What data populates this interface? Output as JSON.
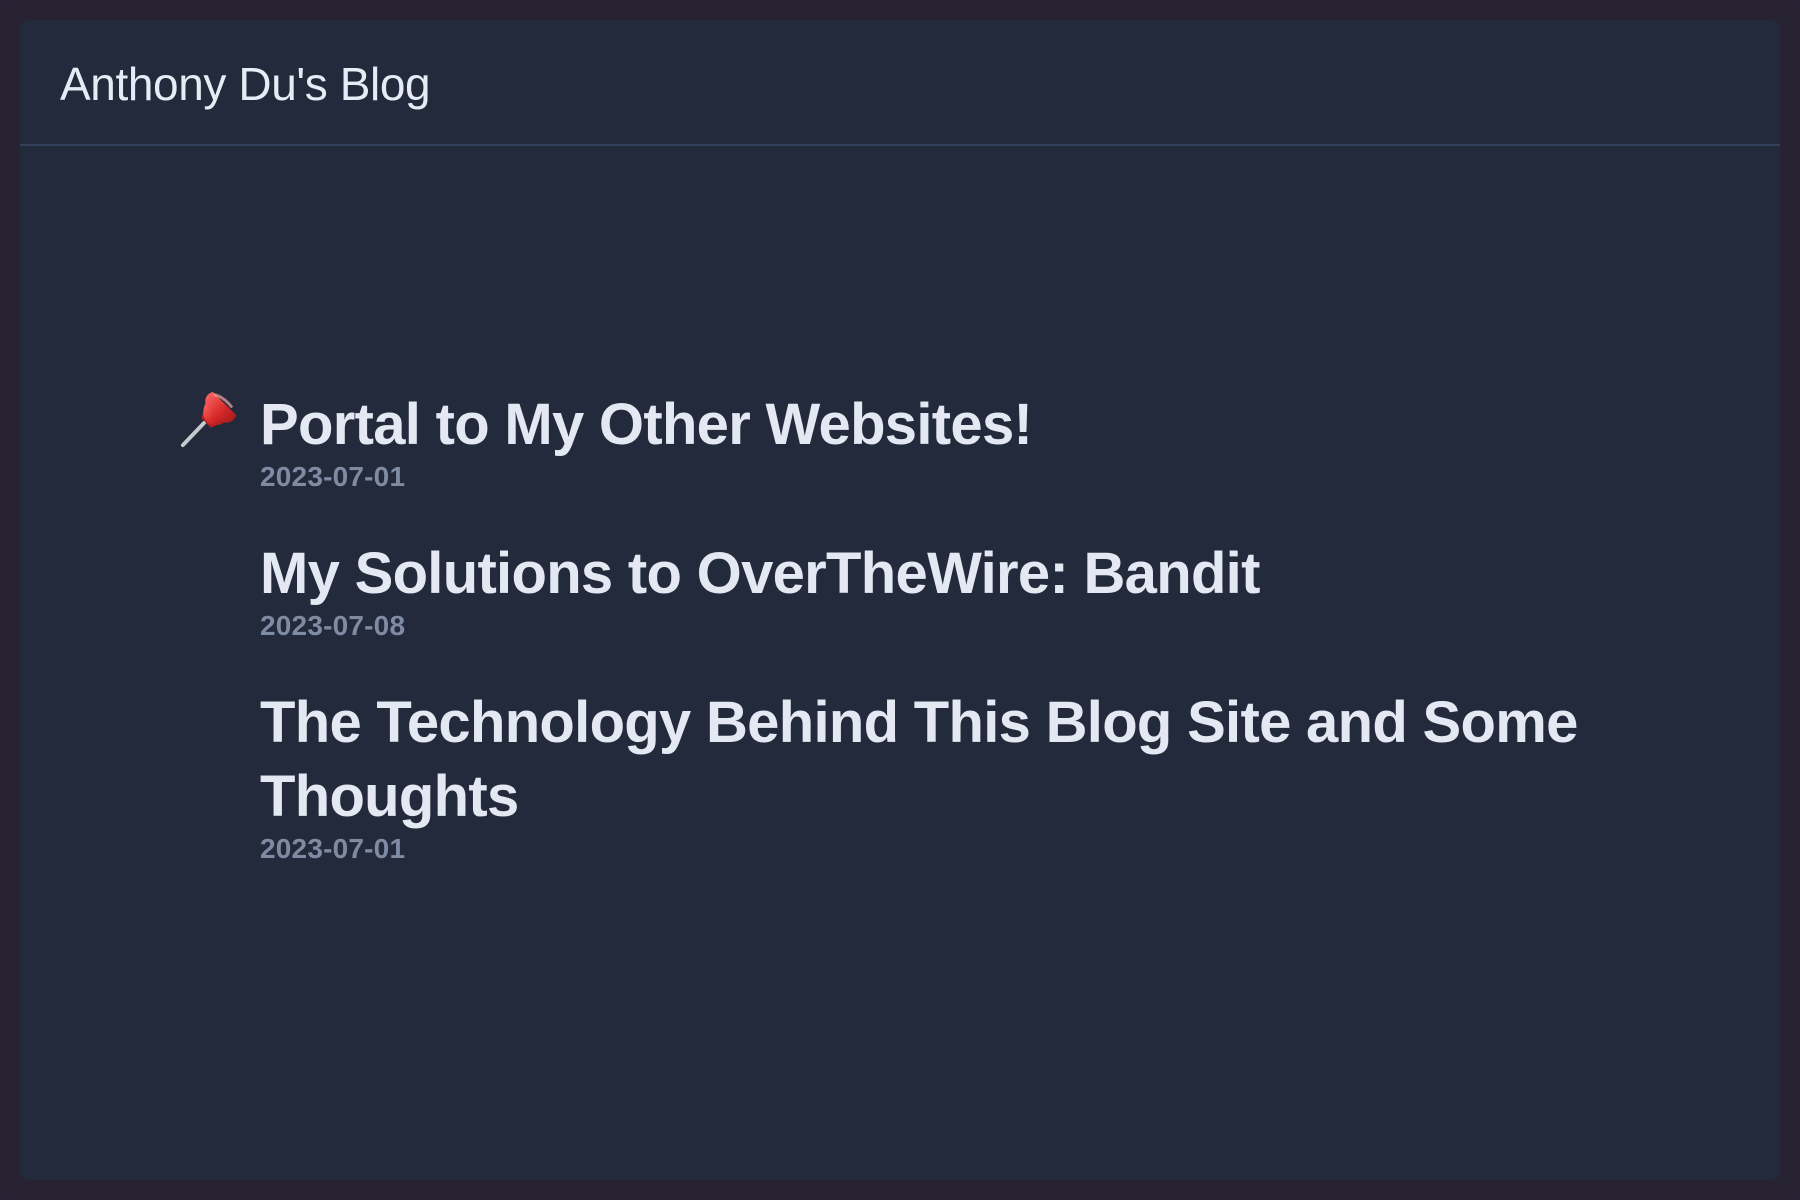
{
  "site": {
    "title": "Anthony Du's Blog"
  },
  "posts": [
    {
      "title": "Portal to My Other Websites!",
      "date": "2023-07-01",
      "pinned": true,
      "icon": "pushpin-icon"
    },
    {
      "title": "My Solutions to OverTheWire: Bandit",
      "date": "2023-07-08",
      "pinned": false
    },
    {
      "title": "The Technology Behind This Blog Site and Some Thoughts",
      "date": "2023-07-01",
      "pinned": false
    }
  ],
  "colors": {
    "window_frame": "#272333",
    "page_background": "#222a3b",
    "header_border": "#34405a",
    "title_text": "#e3e8f2",
    "date_text": "#7f8aa3",
    "pin_red": "#e03a3a"
  }
}
